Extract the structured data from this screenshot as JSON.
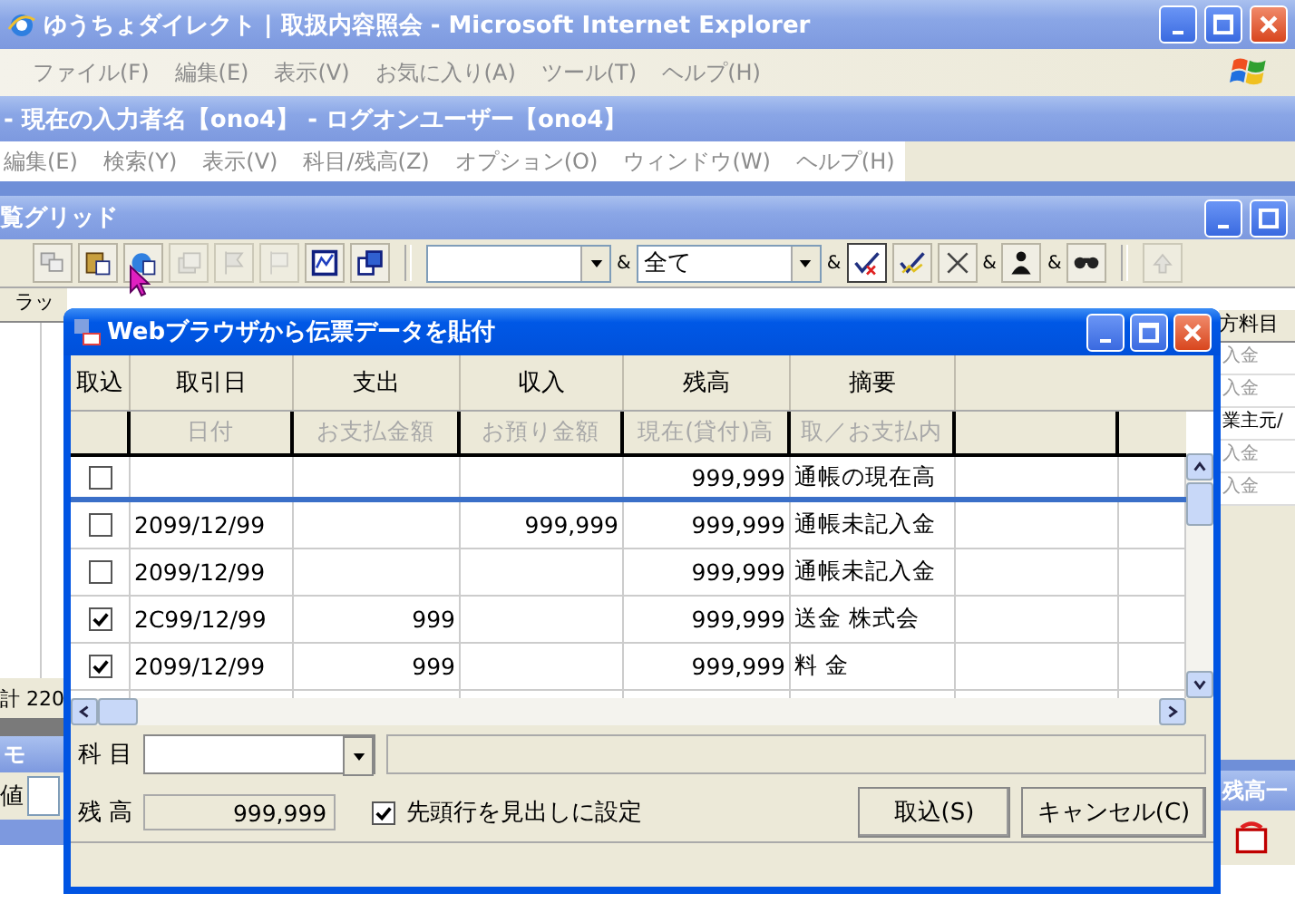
{
  "browser": {
    "title": "ゆうちょダイレクト | 取扱内容照会 - Microsoft Internet Explorer",
    "menu": [
      "ファイル(F)",
      "編集(E)",
      "表示(V)",
      "お気に入り(A)",
      "ツール(T)",
      "ヘルプ(H)"
    ]
  },
  "app": {
    "title": "- 現在の入力者名【ono4】 - ログオンユーザー【ono4】",
    "menu": [
      "編集(E)",
      "検索(Y)",
      "表示(V)",
      "科目/残高(Z)",
      "オプション(O)",
      "ウィンドウ(W)",
      "ヘルプ(H)"
    ]
  },
  "grid_window": {
    "title": "覧グリッド",
    "combo_value": "全て",
    "joiners": [
      "&",
      "&",
      "&",
      "&"
    ]
  },
  "background": {
    "left_header": "ラッ",
    "total": "計 220",
    "memo_title": "モ",
    "value_label": "値",
    "right_header": "方料目",
    "right_cells": [
      "入金",
      "入金",
      "業主元/",
      "入金",
      "入金"
    ],
    "right_panel_title": "残高一"
  },
  "dialog": {
    "title": "Webブラウザから伝票データを貼付",
    "columns": [
      {
        "label": "取込"
      },
      {
        "label": "取引日",
        "sublabel": "日付"
      },
      {
        "label": "支出",
        "sublabel": "お支払金額"
      },
      {
        "label": "収入",
        "sublabel": "お預り金額"
      },
      {
        "label": "残高",
        "sublabel": "現在(貸付)高"
      },
      {
        "label": "摘要",
        "sublabel": "取／お支払内"
      }
    ],
    "rows": [
      {
        "checked": false,
        "balance": "999,999",
        "memo": "通帳の現在高"
      },
      {
        "checked": false,
        "date": "2099/12/99",
        "income": "999,999",
        "balance": "999,999",
        "memo": "通帳未記入金"
      },
      {
        "checked": false,
        "date": "2099/12/99",
        "balance": "999,999",
        "memo": "通帳未記入金"
      },
      {
        "checked": true,
        "date": "2C99/12/99",
        "expense": "999",
        "balance": "999,999",
        "memo": "送金 株式会"
      },
      {
        "checked": true,
        "date": "2099/12/99",
        "expense": "999",
        "balance": "999,999",
        "memo": "料 金"
      }
    ],
    "account_label": "科 目",
    "balance_label": "残 高",
    "balance_value": "999,999",
    "first_row_header": {
      "label": "先頭行を見出しに設定",
      "checked": true
    },
    "buttons": [
      "取込(S)",
      "キャンセル(C)"
    ]
  }
}
